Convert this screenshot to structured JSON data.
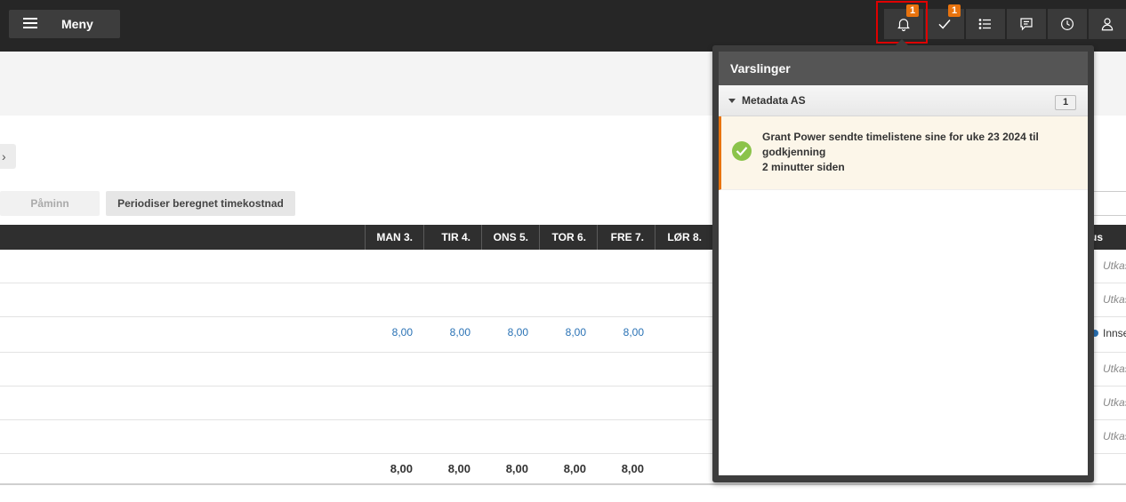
{
  "header": {
    "menu_label": "Meny",
    "notifications_badge": "1",
    "approvals_badge": "1",
    "icons": [
      "bell-icon",
      "check-icon",
      "list-icon",
      "chat-icon",
      "clock-icon",
      "user-icon"
    ]
  },
  "toolbar": {
    "back_arrow": "›",
    "remind_label": "Påminn",
    "periodize_label": "Periodiser beregnet timekostnad"
  },
  "table": {
    "columns": [
      "MAN 3.",
      "TIR 4.",
      "ONS 5.",
      "TOR 6.",
      "FRE 7.",
      "LØR 8."
    ],
    "status_header_fragment": "us",
    "rows": [
      {
        "values": [
          "",
          "",
          "",
          "",
          "",
          ""
        ],
        "status": "Utkas"
      },
      {
        "values": [
          "",
          "",
          "",
          "",
          "",
          ""
        ],
        "status": "Utkas"
      },
      {
        "values": [
          "8,00",
          "8,00",
          "8,00",
          "8,00",
          "8,00",
          ""
        ],
        "status": "Innse"
      },
      {
        "values": [
          "",
          "",
          "",
          "",
          "",
          ""
        ],
        "status": "Utkas"
      },
      {
        "values": [
          "",
          "",
          "",
          "",
          "",
          ""
        ],
        "status": "Utkas"
      },
      {
        "values": [
          "",
          "",
          "",
          "",
          "",
          ""
        ],
        "status": "Utkas"
      }
    ],
    "totals": [
      "8,00",
      "8,00",
      "8,00",
      "8,00",
      "8,00",
      ""
    ]
  },
  "notifications": {
    "title": "Varslinger",
    "group": {
      "name": "Metadata AS",
      "count": "1"
    },
    "items": [
      {
        "line1": "Grant Power sendte timelistene sine for uke 23 2024 til",
        "line2": "godkjenning",
        "time": "2 minutter siden"
      }
    ]
  },
  "colors": {
    "accent": "#e8730e",
    "topbar": "#262626",
    "link": "#2a72b5",
    "success": "#8bc34a",
    "highlight": "#e00000"
  }
}
